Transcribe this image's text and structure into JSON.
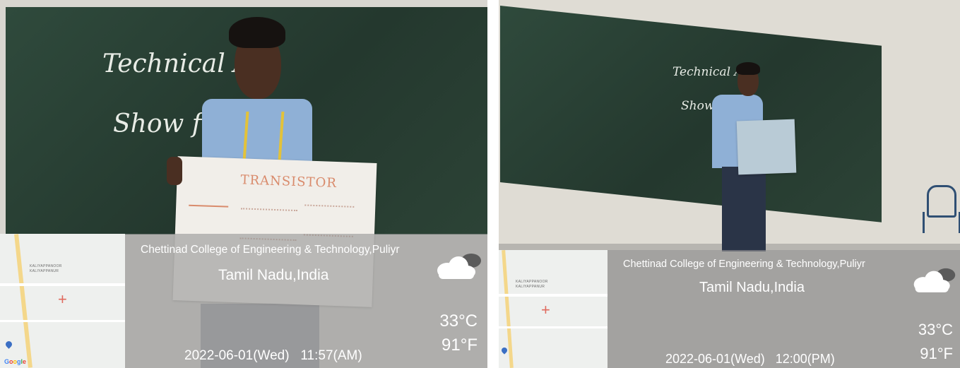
{
  "photos": [
    {
      "location_line1": "Chettinad College of Engineering & Technology,Puliyr",
      "location_line2": "Tamil Nadu,India",
      "temp_c": "33°C",
      "temp_f": "91°F",
      "datetime": "2022-06-01(Wed)   11:57(AM)",
      "board_text_1": "Technical   Ac",
      "board_text_2": "Show  f  T",
      "chart_title": "TRANSISTOR",
      "map_labels": [
        "KALIYAPPANOOR",
        "KALIYAPPANUR"
      ],
      "google_logo": "Google",
      "weather_icon": "cloud-sun-icon",
      "map_pin_icon": "red-cross-marker-icon"
    },
    {
      "location_line1": "Chettinad College of Engineering & Technology,Puliyr",
      "location_line2": "Tamil Nadu,India",
      "temp_c": "33°C",
      "temp_f": "91°F",
      "datetime": "2022-06-01(Wed)   12:00(PM)",
      "board_text_1": "Technical   Ac",
      "board_text_2": "Show  f",
      "map_labels": [
        "KALIYAPPANOOR",
        "KALIYAPPANUR"
      ],
      "weather_icon": "cloud-sun-icon",
      "map_pin_icon": "red-cross-marker-icon"
    }
  ]
}
